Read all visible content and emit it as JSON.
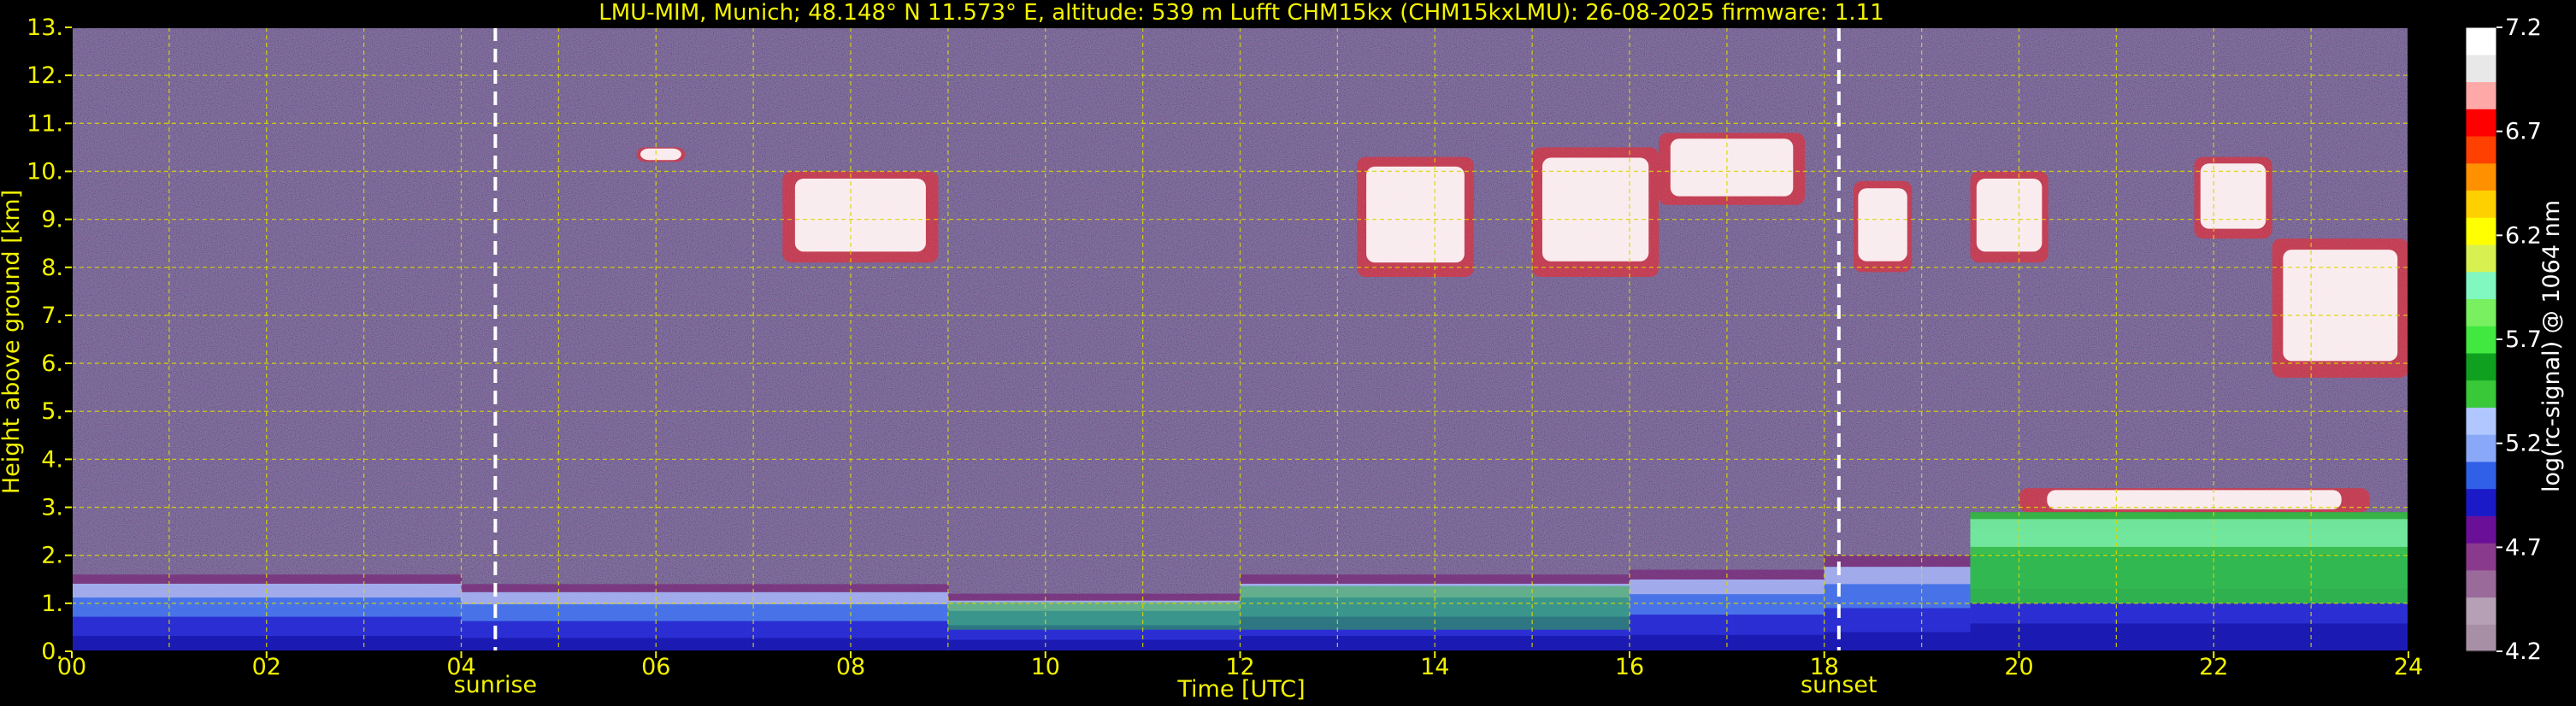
{
  "chart_data": {
    "type": "heatmap",
    "title": "LMU-MIM, Munich; 48.148° N 11.573° E, altitude: 539 m    Lufft CHM15kx (CHM15kxLMU): 26-08-2025    firmware: 1.11",
    "xlabel": "Time [UTC]",
    "ylabel": "Height above ground [km]",
    "x_ticks": [
      "00",
      "02",
      "04",
      "06",
      "08",
      "10",
      "12",
      "14",
      "16",
      "18",
      "20",
      "22",
      "24"
    ],
    "y_ticks": [
      "0.",
      "1.",
      "2.",
      "3.",
      "4.",
      "5.",
      "6.",
      "7.",
      "8.",
      "9.",
      "10.",
      "11.",
      "12.",
      "13."
    ],
    "xlim": [
      0,
      24
    ],
    "ylim": [
      0,
      13
    ],
    "grid": true,
    "markers": [
      {
        "label": "sunrise",
        "x": 4.35
      },
      {
        "label": "sunset",
        "x": 18.15
      }
    ],
    "colorbar": {
      "label": "log(rc-signal) @ 1064 nm",
      "ticks": [
        "4.2",
        "4.7",
        "5.2",
        "5.7",
        "6.2",
        "6.7",
        "7.2"
      ],
      "range": [
        4.2,
        7.2
      ]
    },
    "features": {
      "boundary_layer": [
        {
          "t0": 0,
          "t1": 4,
          "top": 1.6
        },
        {
          "t0": 4,
          "t1": 9,
          "top": 1.4
        },
        {
          "t0": 9,
          "t1": 12,
          "top": 1.2
        },
        {
          "t0": 12,
          "t1": 16,
          "top": 1.6
        },
        {
          "t0": 16,
          "t1": 18,
          "top": 1.7
        },
        {
          "t0": 18,
          "t1": 19.5,
          "top": 2.0
        },
        {
          "t0": 19.5,
          "t1": 24,
          "top": 2.9
        }
      ],
      "clouds": [
        {
          "t0": 5.8,
          "t1": 6.3,
          "bottom": 10.2,
          "top": 10.5
        },
        {
          "t0": 7.3,
          "t1": 8.9,
          "bottom": 8.1,
          "top": 10.0
        },
        {
          "t0": 13.2,
          "t1": 14.4,
          "bottom": 7.8,
          "top": 10.3
        },
        {
          "t0": 15.0,
          "t1": 16.3,
          "bottom": 7.8,
          "top": 10.5
        },
        {
          "t0": 16.3,
          "t1": 17.8,
          "bottom": 9.3,
          "top": 10.8
        },
        {
          "t0": 18.3,
          "t1": 18.9,
          "bottom": 7.9,
          "top": 9.8
        },
        {
          "t0": 19.5,
          "t1": 20.3,
          "bottom": 8.1,
          "top": 10.0
        },
        {
          "t0": 21.8,
          "t1": 22.6,
          "bottom": 8.6,
          "top": 10.3
        },
        {
          "t0": 22.6,
          "t1": 24.0,
          "bottom": 5.7,
          "top": 8.6
        },
        {
          "t0": 20.0,
          "t1": 23.6,
          "bottom": 2.9,
          "top": 3.4
        }
      ]
    }
  },
  "colors": {
    "axis_text": "#f2f200",
    "grid": "#d8d800",
    "marker": "#ffffff",
    "colorbar_text": "#ffffff",
    "colormap": [
      "#a790a6",
      "#b6a0b5",
      "#9a6a9a",
      "#8a3a8c",
      "#6a1098",
      "#1a1ac8",
      "#3060e8",
      "#8aa8f8",
      "#b0c8ff",
      "#38c838",
      "#10a020",
      "#40e840",
      "#78f060",
      "#80f8c0",
      "#d8f050",
      "#ffff00",
      "#ffd000",
      "#ff9000",
      "#ff4000",
      "#ff0000",
      "#ffa8a8",
      "#e8e8e8",
      "#ffffff"
    ]
  }
}
